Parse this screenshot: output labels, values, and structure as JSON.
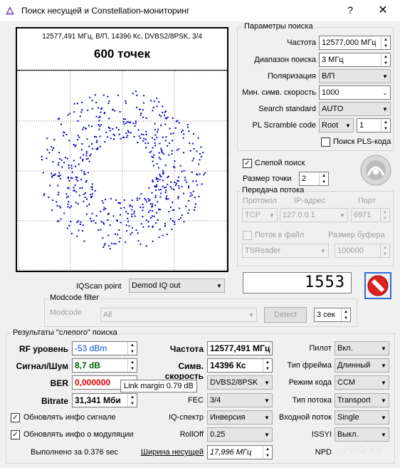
{
  "window": {
    "title": "Поиск несущей и Constellation-мониторинг",
    "help": "?",
    "close": "✕"
  },
  "scope": {
    "info": "12577,491 МГц, В/П, 14396 Кс, DVBS2/8PSK, 3/4",
    "points": "600 точек",
    "dot_color": "#0000c8"
  },
  "search_params": {
    "title": "Параметры поиска",
    "frequency_label": "Частота",
    "frequency_value": "12577,000 МГц",
    "range_label": "Диапазон поиска",
    "range_value": "3 МГц",
    "polarization_label": "Поляризация",
    "polarization_value": "В/П",
    "min_sr_label": "Мин. симв. скорость",
    "min_sr_value": "1000",
    "standard_label": "Search standard",
    "standard_value": "AUTO",
    "pls_label": "PL Scramble code",
    "pls_mode": "Root",
    "pls_value": "1",
    "pls_search_label": "Поиск PLS-кода"
  },
  "blind": {
    "label": "Слепой поиск",
    "checked": "✓",
    "dot_size_label": "Размер точки",
    "dot_size_value": "2"
  },
  "stream": {
    "title": "Передача потока",
    "protocol_label": "Протокол",
    "ip_label": "IP-адрес",
    "port_label": "Порт",
    "protocol_value": "TCP",
    "ip_value": "127.0.0.1",
    "port_value": "6971",
    "to_file_label": "Поток в файл",
    "buffer_label": "Размер буфера",
    "app_value": "TSReader",
    "buffer_value": "100000"
  },
  "counter": "1553",
  "iq": {
    "label": "IQScan point",
    "value": "Demod IQ out"
  },
  "modcode": {
    "title": "Modcode filter",
    "label": "Modcode",
    "value": "All",
    "detect": "Detect",
    "seconds": "3 сек"
  },
  "results": {
    "title": "Результаты \"слепого\" поиска",
    "rf_label": "RF уровень",
    "rf_value": "-53 dBm",
    "rf_color": "#0050d0",
    "snr_label": "Сигнал/Шум",
    "snr_value": "8,7 dB",
    "snr_color": "#006400",
    "ber_label": "BER",
    "ber_value": "0,000000",
    "ber_color": "#e00000",
    "bitrate_label": "Bitrate",
    "bitrate_value": "31,341 Мби",
    "freq_label": "Частота",
    "freq_value": "12577,491 МГц",
    "sr_label": "Симв. скорость",
    "sr_value": "14396 Кс",
    "mod_value": "DVBS2/8PSK",
    "fec_label": "FEC",
    "fec_value": "3/4",
    "iq_label": "IQ-спектр",
    "iq_value": "Инверсия",
    "rolloff_label": "RollOff",
    "rolloff_value": "0.25",
    "bw_label": "Ширина несущей",
    "bw_value": "17,996 МГц",
    "pilot_label": "Пилот",
    "pilot_value": "Вкл.",
    "frame_label": "Тип фрейма",
    "frame_value": "Длинный",
    "mode_label": "Режим кода",
    "mode_value": "CCM",
    "stream_type_label": "Тип потока",
    "stream_type_value": "Transport",
    "input_label": "Входной поток",
    "input_value": "Single",
    "issyi_label": "ISSYI",
    "issyi_value": "Выкл.",
    "npd_label": "NPD",
    "update_signal_label": "Обновлять инфо сигнале",
    "update_mod_label": "Обновлять инфо о модуляции",
    "done_label": "Выполнено за 0.376 sec",
    "tooltip": "Link margin 0.79 dB",
    "watermark": "PRO TV"
  }
}
